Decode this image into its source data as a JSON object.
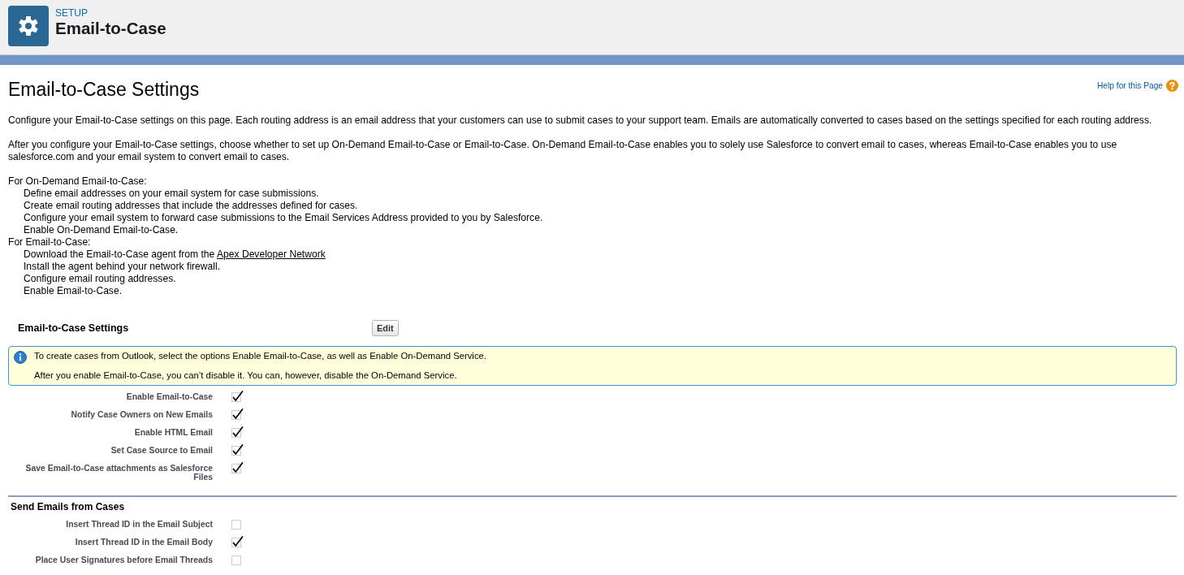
{
  "header": {
    "breadcrumb": "SETUP",
    "title": "Email-to-Case"
  },
  "page": {
    "title": "Email-to-Case Settings",
    "help_link": "Help for this Page"
  },
  "intro": [
    "Configure your Email-to-Case settings on this page. Each routing address is an email address that your customers can use to submit cases to your support team. Emails are automatically converted to cases based on the settings specified for each routing address.",
    "After you configure your Email-to-Case settings, choose whether to set up On-Demand Email-to-Case or Email-to-Case. On-Demand Email-to-Case enables you to solely use Salesforce to convert email to cases, whereas Email-to-Case enables you to use salesforce.com and your email system to convert email to cases."
  ],
  "instructions": [
    {
      "heading": "For On-Demand Email-to-Case:",
      "steps": [
        {
          "text": "Define email addresses on your email system for case submissions."
        },
        {
          "text": "Create email routing addresses that include the addresses defined for cases."
        },
        {
          "text": "Configure your email system to forward case submissions to the Email Services Address provided to you by Salesforce."
        },
        {
          "text": "Enable On-Demand Email-to-Case."
        }
      ]
    },
    {
      "heading": "For Email-to-Case:",
      "steps": [
        {
          "text": "Download the Email-to-Case agent from the",
          "link": "Apex Developer Network"
        },
        {
          "text": "Install the agent behind your network firewall."
        },
        {
          "text": "Configure email routing addresses."
        },
        {
          "text": "Enable Email-to-Case."
        }
      ]
    }
  ],
  "settings_section": {
    "title": "Email-to-Case Settings",
    "edit_button": "Edit",
    "info": [
      "To create cases from Outlook, select the options Enable Email-to-Case, as well as Enable On-Demand Service.",
      "After you enable Email-to-Case, you can’t disable it. You can, however, disable the On-Demand Service."
    ],
    "fields": [
      {
        "label": "Enable Email-to-Case",
        "checked": true
      },
      {
        "label": "Notify Case Owners on New Emails",
        "checked": true
      },
      {
        "label": "Enable HTML Email",
        "checked": true
      },
      {
        "label": "Set Case Source to Email",
        "checked": true
      },
      {
        "label": "Save Email-to-Case attachments as Salesforce Files",
        "checked": true
      }
    ]
  },
  "send_section": {
    "title": "Send Emails from Cases",
    "fields": [
      {
        "label": "Insert Thread ID in the Email Subject",
        "checked": false
      },
      {
        "label": "Insert Thread ID in the Email Body",
        "checked": true
      },
      {
        "label": "Place User Signatures before Email Threads",
        "checked": false
      }
    ]
  }
}
